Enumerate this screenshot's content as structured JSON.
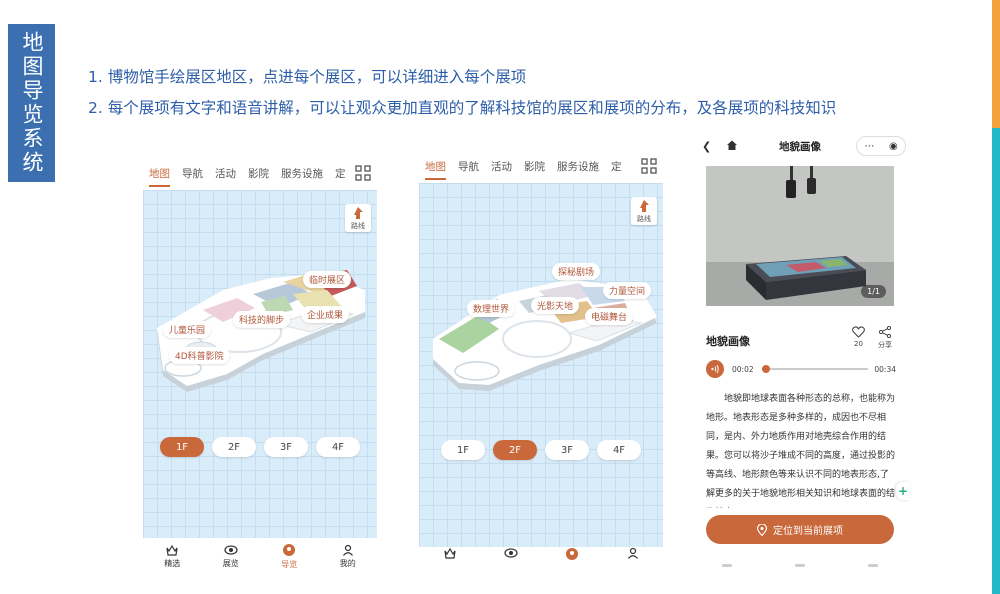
{
  "title": "地图导览系统",
  "bullets": [
    "1. 博物馆手绘展区地区，点进每个展区，可以详细进入每个展项",
    "2. 每个展项有文字和语音讲解，可以让观众更加直观的了解科技馆的展区和展项的分布，及各展项的科技知识"
  ],
  "colors": {
    "accent": "#c9683a",
    "title_bg": "#3b6fb0",
    "bullet_text": "#2d5ea8",
    "map_bg": "#d9ecf9"
  },
  "phone1": {
    "tabs": [
      "地图",
      "导航",
      "活动",
      "影院",
      "服务设施",
      "定"
    ],
    "active_tab": 0,
    "route_label": "路线",
    "areas": [
      "临时展区",
      "科技的脚步",
      "企业成果",
      "儿童乐园",
      "4D科普影院"
    ],
    "floors": [
      "1F",
      "2F",
      "3F",
      "4F"
    ],
    "active_floor": 0,
    "nav": [
      {
        "label": "精选",
        "icon": "crown-icon"
      },
      {
        "label": "展览",
        "icon": "eye-icon"
      },
      {
        "label": "导览",
        "icon": "guide-icon"
      },
      {
        "label": "我的",
        "icon": "person-icon"
      }
    ],
    "active_nav": 2
  },
  "phone2": {
    "tabs": [
      "地图",
      "导航",
      "活动",
      "影院",
      "服务设施",
      "定"
    ],
    "active_tab": 0,
    "route_label": "路线",
    "areas": [
      "探秘剧场",
      "力量空间",
      "数理世界",
      "光影天地",
      "电磁舞台"
    ],
    "floors": [
      "1F",
      "2F",
      "3F",
      "4F"
    ],
    "active_floor": 1
  },
  "phone3": {
    "page_title": "地貌画像",
    "photo_count": "1/1",
    "exhibit_title": "地貌画像",
    "like_count": "20",
    "share_label": "分享",
    "audio": {
      "current": "00:02",
      "total": "00:34",
      "progress": 0.04
    },
    "description": "地貌即地球表面各种形态的总称，也能称为地形。地表形态是多种多样的，成因也不尽相同，是内、外力地质作用对地壳综合作用的结果。您可以将沙子堆成不同的高度，通过投影的等高线、地形颜色等来认识不同的地表形态,了解更多的关于地貌地形相关知识和地球表面的结构特点。",
    "locate_label": "定位到当前展项"
  }
}
